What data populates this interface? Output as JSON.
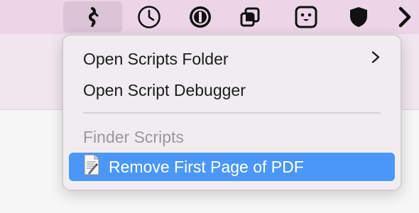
{
  "menubar": {
    "items": [
      {
        "icon": "script-icon",
        "active": true
      },
      {
        "icon": "clock-icon"
      },
      {
        "icon": "onepassword-icon"
      },
      {
        "icon": "window-stack-icon"
      },
      {
        "icon": "face-icon"
      },
      {
        "icon": "shield-icon"
      },
      {
        "icon": "chevron-right-icon"
      }
    ],
    "bg_color": "#ecd5e6"
  },
  "menu": {
    "items": [
      {
        "label": "Open Scripts Folder",
        "has_submenu": true
      },
      {
        "label": "Open Script Debugger"
      }
    ],
    "section_header": "Finder Scripts",
    "scripts": [
      {
        "label": "Remove First Page of PDF",
        "icon": "applescript-document-icon",
        "highlighted": true
      }
    ],
    "highlight_color": "#4a97f7"
  }
}
